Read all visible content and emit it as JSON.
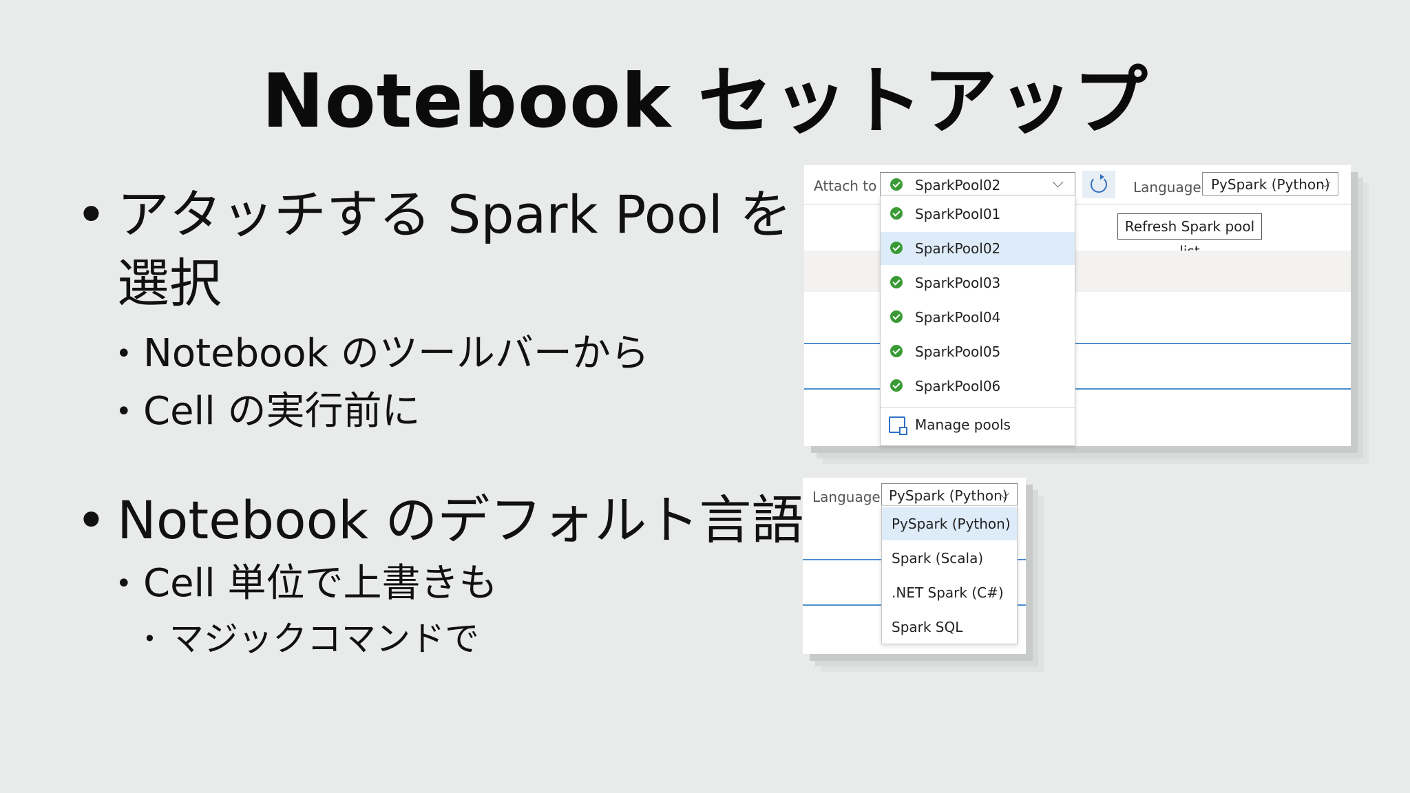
{
  "slide": {
    "title": "Notebook セットアップ",
    "bullets": [
      "アタッチする Spark Pool を選択",
      "Notebook のツールバーから",
      "Cell の実行前に",
      "Notebook のデフォルト言語",
      "Cell 単位で上書きも",
      "マジックコマンドで"
    ]
  },
  "screenshot_pool": {
    "attach_to_label": "Attach to",
    "selected_pool": "SparkPool02",
    "language_label": "Language",
    "language_value": "PySpark (Python)",
    "refresh_tooltip": "Refresh Spark pool list",
    "pools": [
      "SparkPool01",
      "SparkPool02",
      "SparkPool03",
      "SparkPool04",
      "SparkPool05",
      "SparkPool06"
    ],
    "manage_pools_label": "Manage pools",
    "colors": {
      "check": "#3a9b36",
      "selected_bg": "#deecf9",
      "accent": "#2f6fc1"
    },
    "icons": [
      "check-icon",
      "chevron-down-icon",
      "refresh-icon",
      "manage-pools-icon"
    ]
  },
  "screenshot_language": {
    "language_label": "Language",
    "selected_language": "PySpark (Python)",
    "options": [
      "PySpark (Python)",
      "Spark (Scala)",
      ".NET Spark (C#)",
      "Spark SQL"
    ]
  }
}
